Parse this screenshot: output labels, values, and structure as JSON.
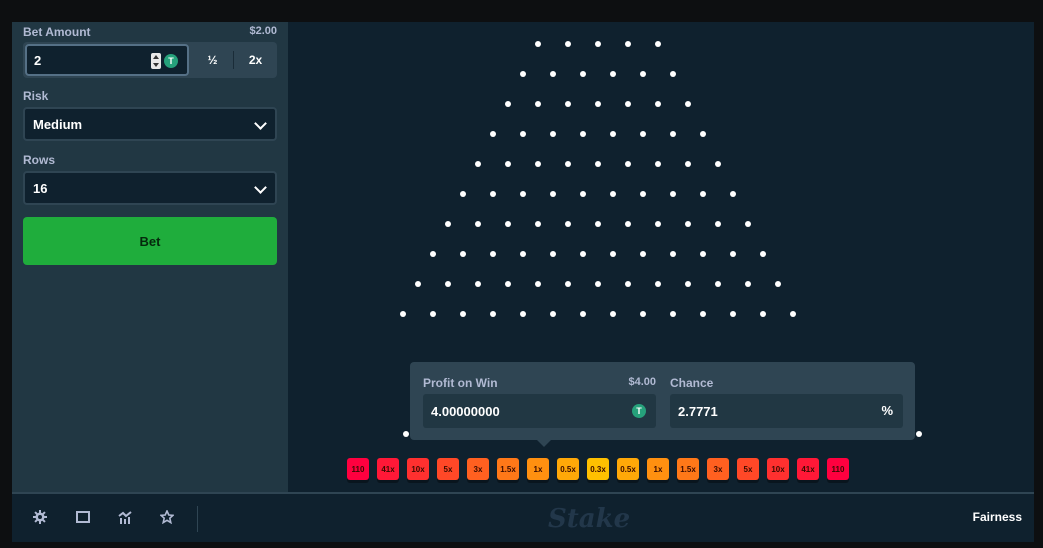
{
  "sidebar": {
    "bet_amount_label": "Bet Amount",
    "bet_amount_usd": "$2.00",
    "bet_amount_value": "2",
    "half_label": "½",
    "double_label": "2x",
    "risk_label": "Risk",
    "risk_value": "Medium",
    "rows_label": "Rows",
    "rows_value": "16",
    "bet_button_label": "Bet"
  },
  "board": {
    "peg_rows": 10,
    "first_row_pegs": 5,
    "multipliers": [
      "110",
      "41x",
      "10x",
      "5x",
      "3x",
      "1.5x",
      "1x",
      "0.5x",
      "0.3x",
      "0.5x",
      "1x",
      "1.5x",
      "3x",
      "5x",
      "10x",
      "41x",
      "110"
    ],
    "multiplier_colors": [
      "#ff003f",
      "#ff1837",
      "#ff302f",
      "#ff4827",
      "#ff6020",
      "#ff7818",
      "#ff9010",
      "#ffa808",
      "#ffc000",
      "#ffa808",
      "#ff9010",
      "#ff7818",
      "#ff6020",
      "#ff4827",
      "#ff302f",
      "#ff1837",
      "#ff003f"
    ]
  },
  "popup": {
    "profit_label": "Profit on Win",
    "profit_usd": "$4.00",
    "profit_value": "4.00000000",
    "chance_label": "Chance",
    "chance_value": "2.7771",
    "chance_unit": "%"
  },
  "footer": {
    "icons": [
      "gear-icon",
      "square-icon",
      "chart-icon",
      "star-icon"
    ],
    "logo": "Stake",
    "fairness_label": "Fairness"
  },
  "colors": {
    "bet_green": "#1fad3c",
    "panel": "#213743",
    "board_bg": "#0f212e",
    "input_border": "#557086"
  }
}
